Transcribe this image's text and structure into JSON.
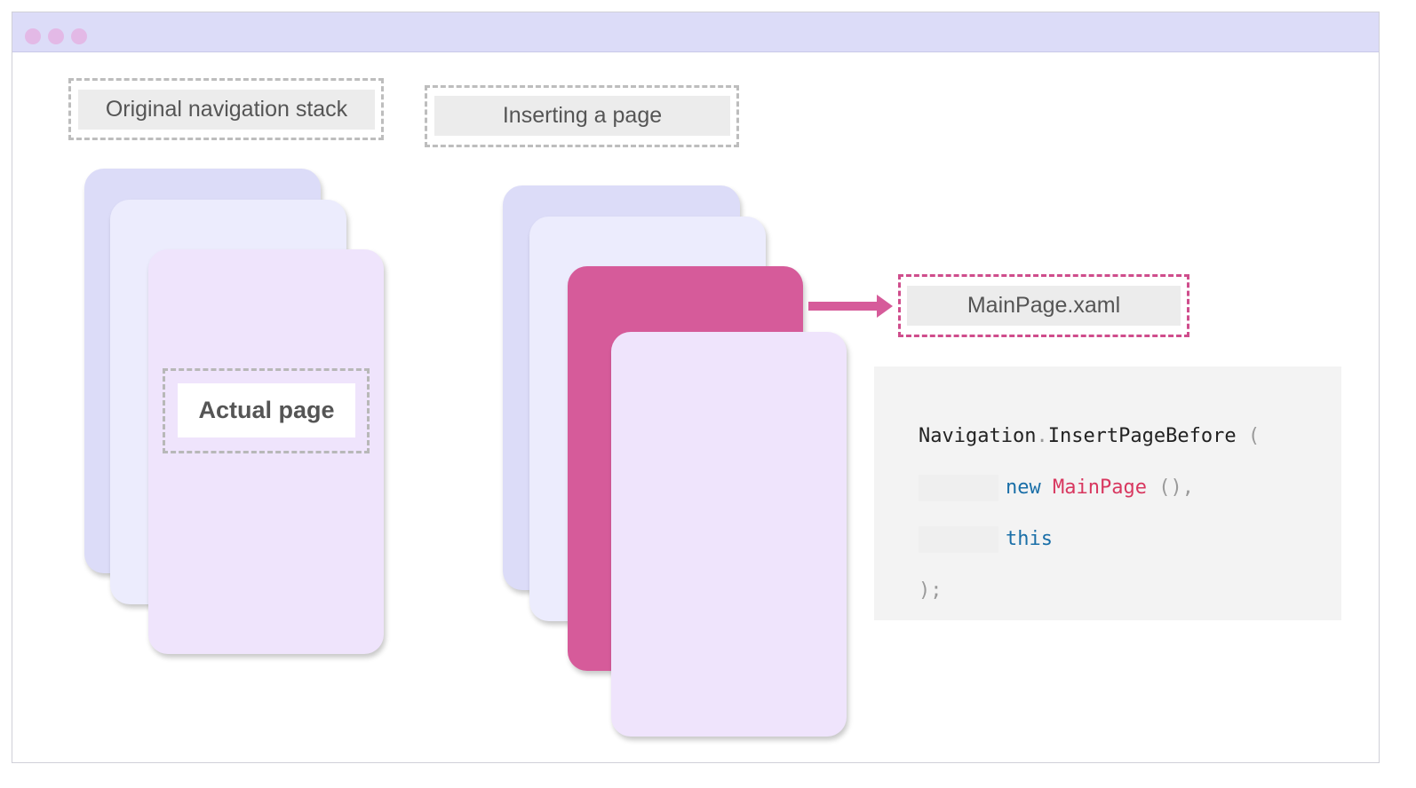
{
  "window": {
    "accent": "#dcdcf8",
    "dots": [
      "dot",
      "dot",
      "dot"
    ]
  },
  "left": {
    "title": "Original navigation stack",
    "actual_label": "Actual page"
  },
  "right": {
    "title": "Inserting a page",
    "inserted_label": "MainPage.xaml",
    "inserted_color": "#d65b9a"
  },
  "code": {
    "line1_object": "Navigation",
    "line1_dot": ".",
    "line1_method": "InsertPageBefore",
    "line1_paren": " (",
    "line2_kw": "new",
    "line2_class": "MainPage",
    "line2_args": " (),",
    "line3_kw": "this",
    "line4": ");"
  },
  "colors": {
    "card_back": "#dcdcf8",
    "card_mid": "#ececfd",
    "card_front": "#efe4fc",
    "arrow": "#d65b9a"
  }
}
